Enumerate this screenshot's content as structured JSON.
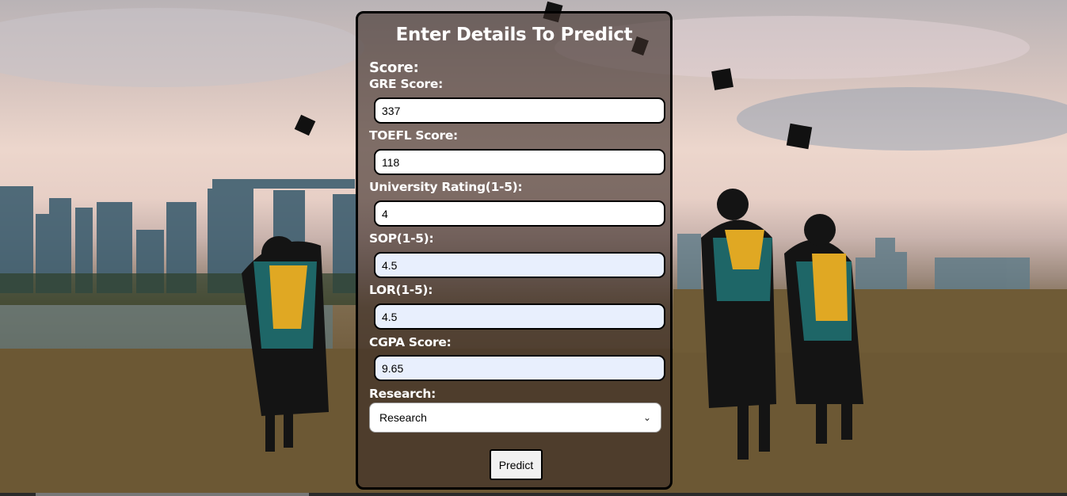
{
  "form": {
    "title": "Enter Details To Predict",
    "score_heading": "Score:",
    "gre": {
      "label": "GRE Score:",
      "value": "337"
    },
    "toefl": {
      "label": "TOEFL Score:",
      "value": "118"
    },
    "university_rating": {
      "label": "University Rating(1-5):",
      "value": "4"
    },
    "sop": {
      "label": "SOP(1-5):",
      "value": "4.5"
    },
    "lor": {
      "label": "LOR(1-5):",
      "value": "4.5"
    },
    "cgpa": {
      "label": "CGPA Score:",
      "value": "9.65"
    },
    "research": {
      "label": "Research:",
      "selected": "Research"
    },
    "predict_label": "Predict"
  },
  "background": {
    "scene": "graduates-throwing-caps-city-skyline"
  },
  "colors": {
    "card_border": "#000000",
    "autofill": "#e8effd",
    "text": "#ffffff"
  }
}
